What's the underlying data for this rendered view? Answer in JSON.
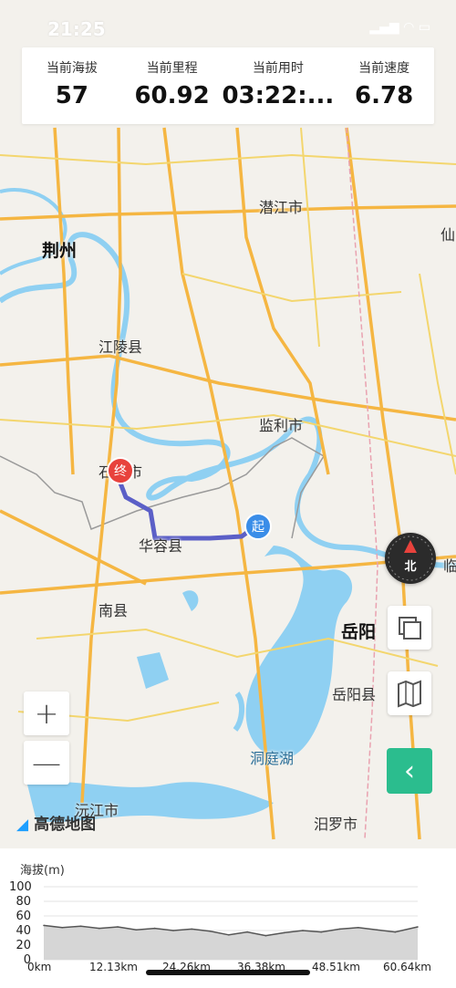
{
  "status": {
    "time": "21:25",
    "icons": "▂▄▆ ◠ ▭"
  },
  "stats": [
    {
      "label": "当前海拔",
      "value": "57"
    },
    {
      "label": "当前里程",
      "value": "60.92"
    },
    {
      "label": "当前用时",
      "value": "03:22:..."
    },
    {
      "label": "当前速度",
      "value": "6.78"
    }
  ],
  "map": {
    "places": {
      "jingzhou": "荆州",
      "qianjiang": "潜江市",
      "xian_edge": "仙",
      "jiangling": "江陵县",
      "jianli": "监利市",
      "shishou": "石首市",
      "huarong": "华容县",
      "nanxian": "南县",
      "yueyang": "岳阳",
      "yueyangxian": "岳阳县",
      "dongtinghu": "洞庭湖",
      "yuanjiang": "沅江市",
      "miluo": "汨罗市",
      "lin_edge": "临"
    },
    "start_marker": "起",
    "end_marker": "终",
    "compass_label": "北",
    "logo_text": "高德地图",
    "route_color": "#5b5fc7",
    "accent_color": "#2bbd8e"
  },
  "controls": {
    "zoom_in": "+",
    "zoom_out": "—",
    "back_icon": "‹"
  },
  "elevation": {
    "title": "海拔(m)",
    "y_ticks": [
      "100",
      "80",
      "60",
      "40",
      "20",
      "0"
    ],
    "x_ticks": [
      "0km",
      "12.13km",
      "24.26km",
      "36.38km",
      "48.51km",
      "60.64km"
    ]
  },
  "chart_data": {
    "type": "area",
    "title": "海拔(m)",
    "xlabel": "",
    "ylabel": "海拔(m)",
    "ylim": [
      0,
      100
    ],
    "xlim": [
      0,
      60.64
    ],
    "x": [
      0,
      3,
      6,
      9,
      12,
      15,
      18,
      21,
      24,
      27,
      30,
      33,
      36,
      39,
      42,
      45,
      48,
      51,
      54,
      57,
      60.64
    ],
    "series": [
      {
        "values": [
          47,
          44,
          46,
          43,
          45,
          41,
          43,
          40,
          42,
          39,
          34,
          38,
          33,
          37,
          40,
          38,
          42,
          44,
          41,
          38,
          45
        ]
      }
    ]
  }
}
